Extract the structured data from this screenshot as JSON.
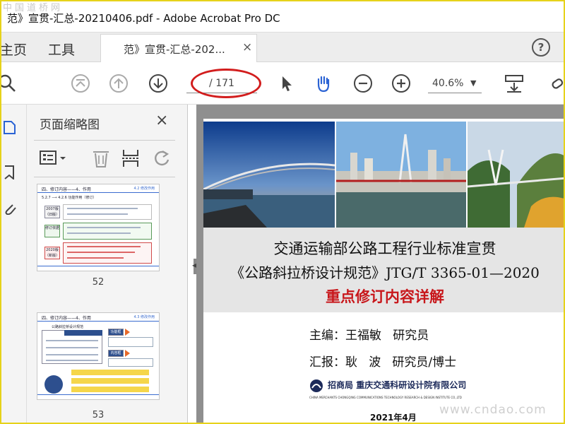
{
  "window": {
    "title": "范》宣贯-汇总-20210406.pdf - Adobe Acrobat Pro DC"
  },
  "watermark": {
    "top": "中国道桥网",
    "bottom": "www.cndao.com"
  },
  "nav": {
    "home": "主页",
    "tools": "工具"
  },
  "tab": {
    "label": "范》宣贯-汇总-202...",
    "close": "×"
  },
  "help": {
    "label": "?"
  },
  "toolbar": {
    "page_total": "/ 171",
    "zoom": "40.6%"
  },
  "panel": {
    "title": "页面缩略图",
    "close": "×",
    "thumbs": [
      {
        "page": "52",
        "title": "四、修订内容——4、作用",
        "tag": "4.2 修改作用",
        "row": "5.2.7 ⟶ 4.2.6  功能作用（修订）",
        "boxes": [
          "2007版（旧版）",
          "修订依据",
          "2020版（新版）"
        ]
      },
      {
        "page": "53",
        "title": "四、修订内容——4、作用",
        "tag": "4.3 修改作用",
        "row": "公路斜拉桥设计规范",
        "boxes": [
          "功能框",
          "内容框",
          "内容框"
        ]
      }
    ]
  },
  "document": {
    "line1": "交通运输部公路工程行业标准宣贯",
    "line2": "《公路斜拉桥设计规范》JTG/T 3365-01—2020",
    "line3": "重点修订内容详解",
    "editor": "主编：王福敏   研究员",
    "reporter": "汇报：耿   波   研究员/博士",
    "company_mark": "招商局",
    "company": "重庆交通科研设计院有限公司",
    "company_en": "CHINA MERCHANTS CHONGQING COMMUNICATIONS TECHNOLOGY RESEARCH & DESIGN INSTITUTE CO.,LTD",
    "date": "2021年4月"
  },
  "colors": {
    "accent": "#d21d1d",
    "red_title": "#c8171b",
    "active_tool": "#2b63d4"
  },
  "icons": [
    "search-icon",
    "first-page-icon",
    "prev-page-icon",
    "next-page-icon",
    "select-arrow-icon",
    "hand-icon",
    "zoom-out-icon",
    "zoom-in-icon",
    "keyboard-scroll-icon",
    "link-icon",
    "thumbnail-options-icon",
    "delete-icon",
    "extract-icon",
    "rotate-icon"
  ]
}
